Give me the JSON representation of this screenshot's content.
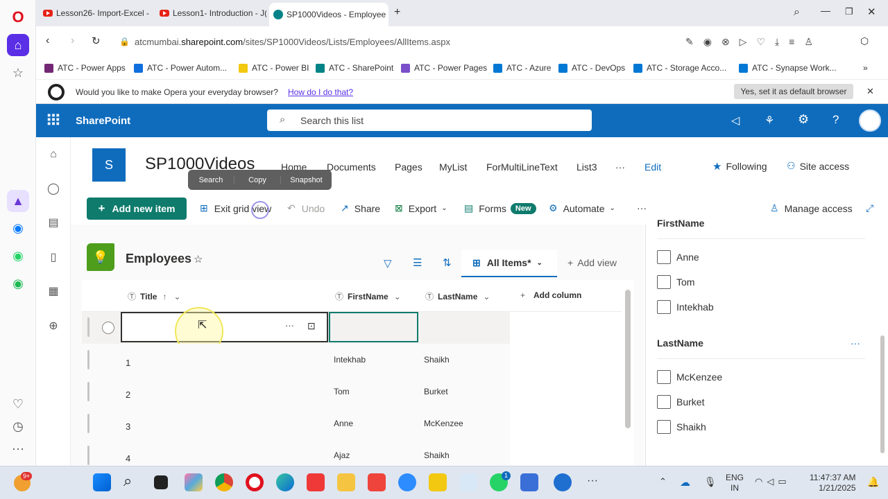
{
  "browser": {
    "tabs": [
      {
        "label": "Lesson26- Import-Excel -"
      },
      {
        "label": "Lesson1- Introduction - J("
      },
      {
        "label": "SP1000Videos - Employee"
      }
    ],
    "url_prefix": "atcmumbai.",
    "url_domain": "sharepoint.com",
    "url_path": "/sites/SP1000Videos/Lists/Employees/AllItems.aspx",
    "bookmarks": [
      {
        "label": "ATC - Power Apps",
        "color": "#742774"
      },
      {
        "label": "ATC - Power Autom...",
        "color": "#0f6fde"
      },
      {
        "label": "ATC - Power BI",
        "color": "#f2c811"
      },
      {
        "label": "ATC - SharePoint",
        "color": "#038387"
      },
      {
        "label": "ATC - Power Pages",
        "color": "#7b4fc9"
      },
      {
        "label": "ATC - Azure",
        "color": "#0078d4"
      },
      {
        "label": "ATC - DevOps",
        "color": "#0078d4"
      },
      {
        "label": "ATC - Storage Acco...",
        "color": "#0078d4"
      },
      {
        "label": "ATC - Synapse Work...",
        "color": "#0078d4"
      }
    ],
    "infobar": {
      "question": "Would you like to make Opera your everyday browser?",
      "link": "How do I do that?",
      "button": "Yes, set it as default browser"
    }
  },
  "sharepoint": {
    "app_name": "SharePoint",
    "search_placeholder": "Search this list",
    "site_logo_letter": "S",
    "site_title": "SP1000Videos",
    "site_nav": [
      "Home",
      "Documents",
      "Pages",
      "MyList",
      "ForMultiLineText",
      "List3",
      "···",
      "Edit"
    ],
    "following": "Following",
    "site_access": "Site access",
    "popup": [
      "Search",
      "Copy",
      "Snapshot"
    ],
    "commands": {
      "add_new_item": "Add new item",
      "exit_grid_view": "Exit grid view",
      "undo": "Undo",
      "share": "Share",
      "export": "Export",
      "forms": "Forms",
      "forms_badge": "New",
      "automate": "Automate",
      "more": "···",
      "manage_access": "Manage access"
    },
    "list": {
      "title": "Employees",
      "view": "All Items*",
      "add_view": "Add view",
      "columns": [
        "Title",
        "FirstName",
        "LastName",
        "Add column"
      ],
      "rows": [
        {
          "title": "1",
          "first": "Intekhab",
          "last": "Shaikh"
        },
        {
          "title": "2",
          "first": "Tom",
          "last": "Burket"
        },
        {
          "title": "3",
          "first": "Anne",
          "last": "McKenzee"
        },
        {
          "title": "4",
          "first": "Ajaz",
          "last": "Shaikh"
        }
      ]
    },
    "filter_pane": {
      "first_heading": "FirstName",
      "first_options": [
        "Anne",
        "Tom",
        "Intekhab"
      ],
      "last_heading": "LastName",
      "last_more": "···",
      "last_options": [
        "McKenzee",
        "Burket",
        "Shaikh"
      ]
    }
  },
  "taskbar": {
    "badge": "9+",
    "lang": "ENG",
    "region": "IN",
    "time": "11:47:37 AM",
    "date": "1/21/2025",
    "whatsapp_badge": "1"
  }
}
